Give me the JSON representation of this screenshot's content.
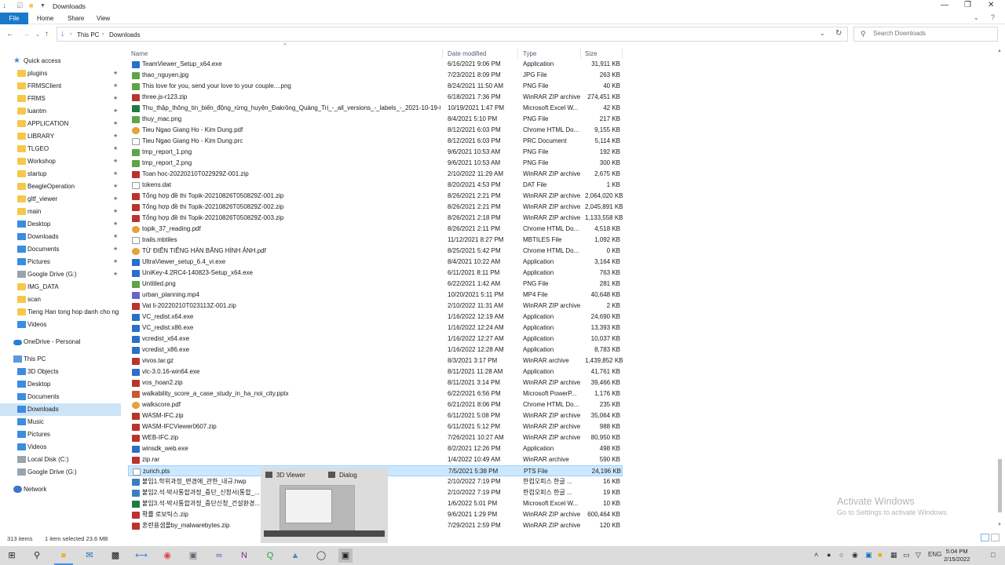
{
  "window": {
    "title": "Downloads",
    "controls": [
      "—",
      "❐",
      "✕"
    ]
  },
  "ribbon": {
    "tabs": [
      "File",
      "Home",
      "Share",
      "View"
    ]
  },
  "address": {
    "crumbs": [
      "This PC",
      "Downloads"
    ],
    "search_placeholder": "Search Downloads"
  },
  "columns": {
    "name": "Name",
    "date": "Date modified",
    "type": "Type",
    "size": "Size"
  },
  "nav": [
    {
      "label": "Quick access",
      "icon": "star-icon",
      "indent": 0,
      "pin": false
    },
    {
      "label": "plugins",
      "icon": "folder-icon",
      "indent": 1,
      "pin": true
    },
    {
      "label": "FRMSClient",
      "icon": "folder-icon",
      "indent": 1,
      "pin": true
    },
    {
      "label": "FRMS",
      "icon": "folder-icon",
      "indent": 1,
      "pin": true
    },
    {
      "label": "luantm",
      "icon": "folder-icon",
      "indent": 1,
      "pin": true
    },
    {
      "label": "APPLICATION",
      "icon": "folder-icon",
      "indent": 1,
      "pin": true
    },
    {
      "label": "LIBRARY",
      "icon": "folder-icon",
      "indent": 1,
      "pin": true
    },
    {
      "label": "TLGEO",
      "icon": "folder-icon",
      "indent": 1,
      "pin": true
    },
    {
      "label": "Workshop",
      "icon": "folder-icon",
      "indent": 1,
      "pin": true
    },
    {
      "label": "startup",
      "icon": "folder-icon",
      "indent": 1,
      "pin": true
    },
    {
      "label": "BeagleOperation",
      "icon": "folder-icon",
      "indent": 1,
      "pin": true
    },
    {
      "label": "gltf_viewer",
      "icon": "folder-icon",
      "indent": 1,
      "pin": true
    },
    {
      "label": "main",
      "icon": "folder-icon",
      "indent": 1,
      "pin": true
    },
    {
      "label": "Desktop",
      "icon": "desktop-icon",
      "indent": 1,
      "pin": true
    },
    {
      "label": "Downloads",
      "icon": "download-icon",
      "indent": 1,
      "pin": true
    },
    {
      "label": "Documents",
      "icon": "documents-icon",
      "indent": 1,
      "pin": true
    },
    {
      "label": "Pictures",
      "icon": "pictures-icon",
      "indent": 1,
      "pin": true
    },
    {
      "label": "Google Drive (G:)",
      "icon": "drive-icon",
      "indent": 1,
      "pin": true
    },
    {
      "label": "IMG_DATA",
      "icon": "folder-icon",
      "indent": 1,
      "pin": false
    },
    {
      "label": "scan",
      "icon": "folder-icon",
      "indent": 1,
      "pin": false
    },
    {
      "label": "Tieng Han tong hop danh cho ng",
      "icon": "folder-icon",
      "indent": 1,
      "pin": false
    },
    {
      "label": "Videos",
      "icon": "videos-icon",
      "indent": 1,
      "pin": false
    },
    {
      "label": "OneDrive - Personal",
      "icon": "onedrive-icon",
      "indent": 0,
      "pin": false,
      "gap": true
    },
    {
      "label": "This PC",
      "icon": "pc-icon",
      "indent": 0,
      "pin": false,
      "gap": true
    },
    {
      "label": "3D Objects",
      "icon": "3d-objects-icon",
      "indent": 1,
      "pin": false
    },
    {
      "label": "Desktop",
      "icon": "desktop-icon",
      "indent": 1,
      "pin": false
    },
    {
      "label": "Documents",
      "icon": "documents-icon",
      "indent": 1,
      "pin": false
    },
    {
      "label": "Downloads",
      "icon": "download-icon",
      "indent": 1,
      "pin": false,
      "selected": true
    },
    {
      "label": "Music",
      "icon": "music-icon",
      "indent": 1,
      "pin": false
    },
    {
      "label": "Pictures",
      "icon": "pictures-icon",
      "indent": 1,
      "pin": false
    },
    {
      "label": "Videos",
      "icon": "videos-icon",
      "indent": 1,
      "pin": false
    },
    {
      "label": "Local Disk (C:)",
      "icon": "drive-icon",
      "indent": 1,
      "pin": false
    },
    {
      "label": "Google Drive (G:)",
      "icon": "drive-icon",
      "indent": 1,
      "pin": false
    },
    {
      "label": "Network",
      "icon": "network-icon",
      "indent": 0,
      "pin": false,
      "gap": true
    }
  ],
  "files": [
    {
      "name": "TeamViewer_Setup_x64.exe",
      "date": "6/16/2021 9:06 PM",
      "type": "Application",
      "size": "31,911 KB",
      "icon": "exe"
    },
    {
      "name": "thao_nguyen.jpg",
      "date": "7/23/2021 8:09 PM",
      "type": "JPG File",
      "size": "263 KB",
      "icon": "img"
    },
    {
      "name": "This love for you, send your love to your couple....png",
      "date": "8/24/2021 11:50 AM",
      "type": "PNG File",
      "size": "40 KB",
      "icon": "img"
    },
    {
      "name": "three.js-r123.zip",
      "date": "6/18/2021 7:36 PM",
      "type": "WinRAR ZIP archive",
      "size": "274,451 KB",
      "icon": "zip"
    },
    {
      "name": "Thu_thập_thông_tin_biến_động_rừng_huyện_Đakrông_Quảng_Trị_-_all_versions_-_labels_-_2021-10-19-04-...",
      "date": "10/19/2021 1:47 PM",
      "type": "Microsoft Excel W...",
      "size": "42 KB",
      "icon": "xls"
    },
    {
      "name": "thuy_mac.png",
      "date": "8/4/2021 5:10 PM",
      "type": "PNG File",
      "size": "217 KB",
      "icon": "img"
    },
    {
      "name": "Tieu Ngao Giang Ho - Kim Dung.pdf",
      "date": "8/12/2021 6:03 PM",
      "type": "Chrome HTML Do...",
      "size": "9,155 KB",
      "icon": "pdf"
    },
    {
      "name": "Tieu Ngao Giang Ho - Kim Dung.prc",
      "date": "8/12/2021 6:03 PM",
      "type": "PRC Document",
      "size": "5,114 KB",
      "icon": "doc"
    },
    {
      "name": "tmp_report_1.png",
      "date": "9/6/2021 10:53 AM",
      "type": "PNG File",
      "size": "192 KB",
      "icon": "img"
    },
    {
      "name": "tmp_report_2.png",
      "date": "9/6/2021 10:53 AM",
      "type": "PNG File",
      "size": "300 KB",
      "icon": "img"
    },
    {
      "name": "Toan hoc-20220210T022929Z-001.zip",
      "date": "2/10/2022 11:29 AM",
      "type": "WinRAR ZIP archive",
      "size": "2,675 KB",
      "icon": "zip"
    },
    {
      "name": "tokens.dat",
      "date": "8/20/2021 4:53 PM",
      "type": "DAT File",
      "size": "1 KB",
      "icon": "doc"
    },
    {
      "name": "Tổng hợp đề thi Topik-20210826T050829Z-001.zip",
      "date": "8/26/2021 2:21 PM",
      "type": "WinRAR ZIP archive",
      "size": "2,064,020 KB",
      "icon": "zip"
    },
    {
      "name": "Tổng hợp đề thi Topik-20210826T050829Z-002.zip",
      "date": "8/26/2021 2:21 PM",
      "type": "WinRAR ZIP archive",
      "size": "2,045,891 KB",
      "icon": "zip"
    },
    {
      "name": "Tổng hợp đề thi Topik-20210826T050829Z-003.zip",
      "date": "8/26/2021 2:18 PM",
      "type": "WinRAR ZIP archive",
      "size": "1,133,558 KB",
      "icon": "zip"
    },
    {
      "name": "topik_37_reading.pdf",
      "date": "8/26/2021 2:11 PM",
      "type": "Chrome HTML Do...",
      "size": "4,518 KB",
      "icon": "pdf"
    },
    {
      "name": "trails.mbtiles",
      "date": "11/12/2021 8:27 PM",
      "type": "MBTILES File",
      "size": "1,092 KB",
      "icon": "doc"
    },
    {
      "name": "TỪ ĐIỂN TIẾNG HÀN BẰNG HÌNH ẢNH.pdf",
      "date": "8/25/2021 5:42 PM",
      "type": "Chrome HTML Do...",
      "size": "0 KB",
      "icon": "pdf"
    },
    {
      "name": "UltraViewer_setup_6.4_vi.exe",
      "date": "8/4/2021 10:22 AM",
      "type": "Application",
      "size": "3,164 KB",
      "icon": "exe"
    },
    {
      "name": "UniKey-4.2RC4-140823-Setup_x64.exe",
      "date": "6/11/2021 8:11 PM",
      "type": "Application",
      "size": "763 KB",
      "icon": "exe"
    },
    {
      "name": "Untitled.png",
      "date": "6/22/2021 1:42 AM",
      "type": "PNG File",
      "size": "281 KB",
      "icon": "img"
    },
    {
      "name": "urban_planning.mp4",
      "date": "10/20/2021 5:11 PM",
      "type": "MP4 File",
      "size": "40,648 KB",
      "icon": "mp4"
    },
    {
      "name": "Vat li-20220210T023113Z-001.zip",
      "date": "2/10/2022 11:31 AM",
      "type": "WinRAR ZIP archive",
      "size": "2 KB",
      "icon": "zip"
    },
    {
      "name": "VC_redist.x64.exe",
      "date": "1/16/2022 12:19 AM",
      "type": "Application",
      "size": "24,690 KB",
      "icon": "exe"
    },
    {
      "name": "VC_redist.x86.exe",
      "date": "1/16/2022 12:24 AM",
      "type": "Application",
      "size": "13,393 KB",
      "icon": "exe"
    },
    {
      "name": "vcredist_x64.exe",
      "date": "1/16/2022 12:27 AM",
      "type": "Application",
      "size": "10,037 KB",
      "icon": "exe"
    },
    {
      "name": "vcredist_x86.exe",
      "date": "1/16/2022 12:28 AM",
      "type": "Application",
      "size": "8,783 KB",
      "icon": "exe"
    },
    {
      "name": "vivos.tar.gz",
      "date": "8/3/2021 3:17 PM",
      "type": "WinRAR archive",
      "size": "1,439,852 KB",
      "icon": "zip"
    },
    {
      "name": "vlc-3.0.16-win64.exe",
      "date": "8/11/2021 11:28 AM",
      "type": "Application",
      "size": "41,761 KB",
      "icon": "exe"
    },
    {
      "name": "vos_hoan2.zip",
      "date": "8/11/2021 3:14 PM",
      "type": "WinRAR ZIP archive",
      "size": "39,466 KB",
      "icon": "zip"
    },
    {
      "name": "walkability_score_a_case_study_in_ha_noi_city.pptx",
      "date": "6/22/2021 6:56 PM",
      "type": "Microsoft PowerP...",
      "size": "1,176 KB",
      "icon": "ppt"
    },
    {
      "name": "walkscore.pdf",
      "date": "6/21/2021 8:06 PM",
      "type": "Chrome HTML Do...",
      "size": "235 KB",
      "icon": "pdf"
    },
    {
      "name": "WASM-IFC.zip",
      "date": "6/11/2021 5:08 PM",
      "type": "WinRAR ZIP archive",
      "size": "35,064 KB",
      "icon": "zip"
    },
    {
      "name": "WASM-IFCViewer0607.zip",
      "date": "6/11/2021 5:12 PM",
      "type": "WinRAR ZIP archive",
      "size": "988 KB",
      "icon": "zip"
    },
    {
      "name": "WEB-IFC.zip",
      "date": "7/26/2021 10:27 AM",
      "type": "WinRAR ZIP archive",
      "size": "80,950 KB",
      "icon": "zip"
    },
    {
      "name": "winsdk_web.exe",
      "date": "8/2/2021 12:26 PM",
      "type": "Application",
      "size": "498 KB",
      "icon": "exe"
    },
    {
      "name": "zip.rar",
      "date": "1/4/2022 10:49 AM",
      "type": "WinRAR archive",
      "size": "590 KB",
      "icon": "zip"
    },
    {
      "name": "zurich.pts",
      "date": "7/5/2021 5:38 PM",
      "type": "PTS File",
      "size": "24,196 KB",
      "icon": "doc",
      "selected": true
    },
    {
      "name": "붙임1.학위과정_변경에_관한_내규.hwp",
      "date": "2/10/2022 7:19 PM",
      "type": "한컴오피스 한글 ...",
      "size": "16 KB",
      "icon": "hwp"
    },
    {
      "name": "붙임2.석·박사통합과정_중단_신청서(통합_...",
      "date": "2/10/2022 7:19 PM",
      "type": "한컴오피스 한글 ...",
      "size": "19 KB",
      "icon": "hwp"
    },
    {
      "name": "붙임3.석·박사통합과정_중단신청_건설환경...",
      "date": "1/6/2022 5:01 PM",
      "type": "Microsoft Excel W...",
      "size": "10 KB",
      "icon": "xls"
    },
    {
      "name": "확률 로보틱스.zip",
      "date": "9/6/2021 1:29 PM",
      "type": "WinRAR ZIP archive",
      "size": "600,464 KB",
      "icon": "zip"
    },
    {
      "name": "혼련용샘플by_malwarebytes.zip",
      "date": "7/29/2021 2:59 PM",
      "type": "WinRAR ZIP archive",
      "size": "120 KB",
      "icon": "zip"
    }
  ],
  "status": {
    "item_count": "313 items",
    "selection": "1 item selected  23.6 MB"
  },
  "watermark": {
    "line1": "Activate Windows",
    "line2": "Go to Settings to activate Windows."
  },
  "thumbnails": {
    "left_title": "3D Viewer",
    "right_title": "Dialog"
  },
  "taskbar": {
    "language": "ENG",
    "time": "5:04 PM",
    "date": "2/15/2022"
  },
  "colors": {
    "accent": "#1979ca",
    "selection": "#cce8ff",
    "nav_selection": "#cce4f7"
  }
}
